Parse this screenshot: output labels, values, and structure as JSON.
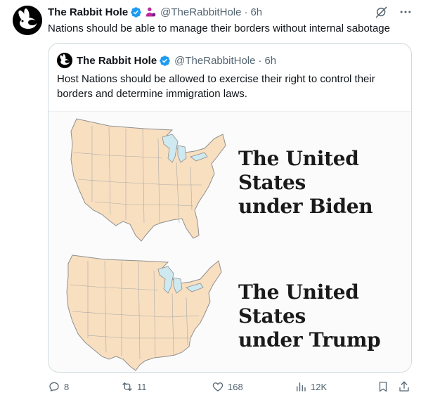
{
  "post": {
    "author_name": "The Rabbit Hole",
    "handle": "@TheRabbitHole",
    "separator": "·",
    "time": "6h",
    "text": "Nations should be able to manage their borders without internal sabotage",
    "verified_color": "#1d9bf0",
    "affiliate_color": "#c0279c"
  },
  "quote": {
    "author_name": "The Rabbit Hole",
    "handle": "@TheRabbitHole",
    "separator": "·",
    "time": "6h",
    "text": "Host Nations should be allowed to exercise their right to control their borders and determine immigration laws.",
    "image": {
      "map_top_caption_line1": "The United States",
      "map_top_caption_line2": "under Biden",
      "map_bottom_caption_line1": "The United States",
      "map_bottom_caption_line2": "under Trump",
      "map_fill_color": "#f8dfc0",
      "lake_color": "#cfe9f0"
    }
  },
  "actions": {
    "replies": "8",
    "reposts": "11",
    "likes": "168",
    "views": "12K"
  },
  "icons": {
    "avatar": "rabbit-logo-icon",
    "verified": "verified-badge-icon",
    "affiliate": "affiliate-person-icon",
    "grok": "grok-icon",
    "more": "more-options-icon",
    "reply": "reply-icon",
    "repost": "repost-icon",
    "like": "heart-icon",
    "views": "views-chart-icon",
    "bookmark": "bookmark-icon",
    "share": "share-icon"
  }
}
